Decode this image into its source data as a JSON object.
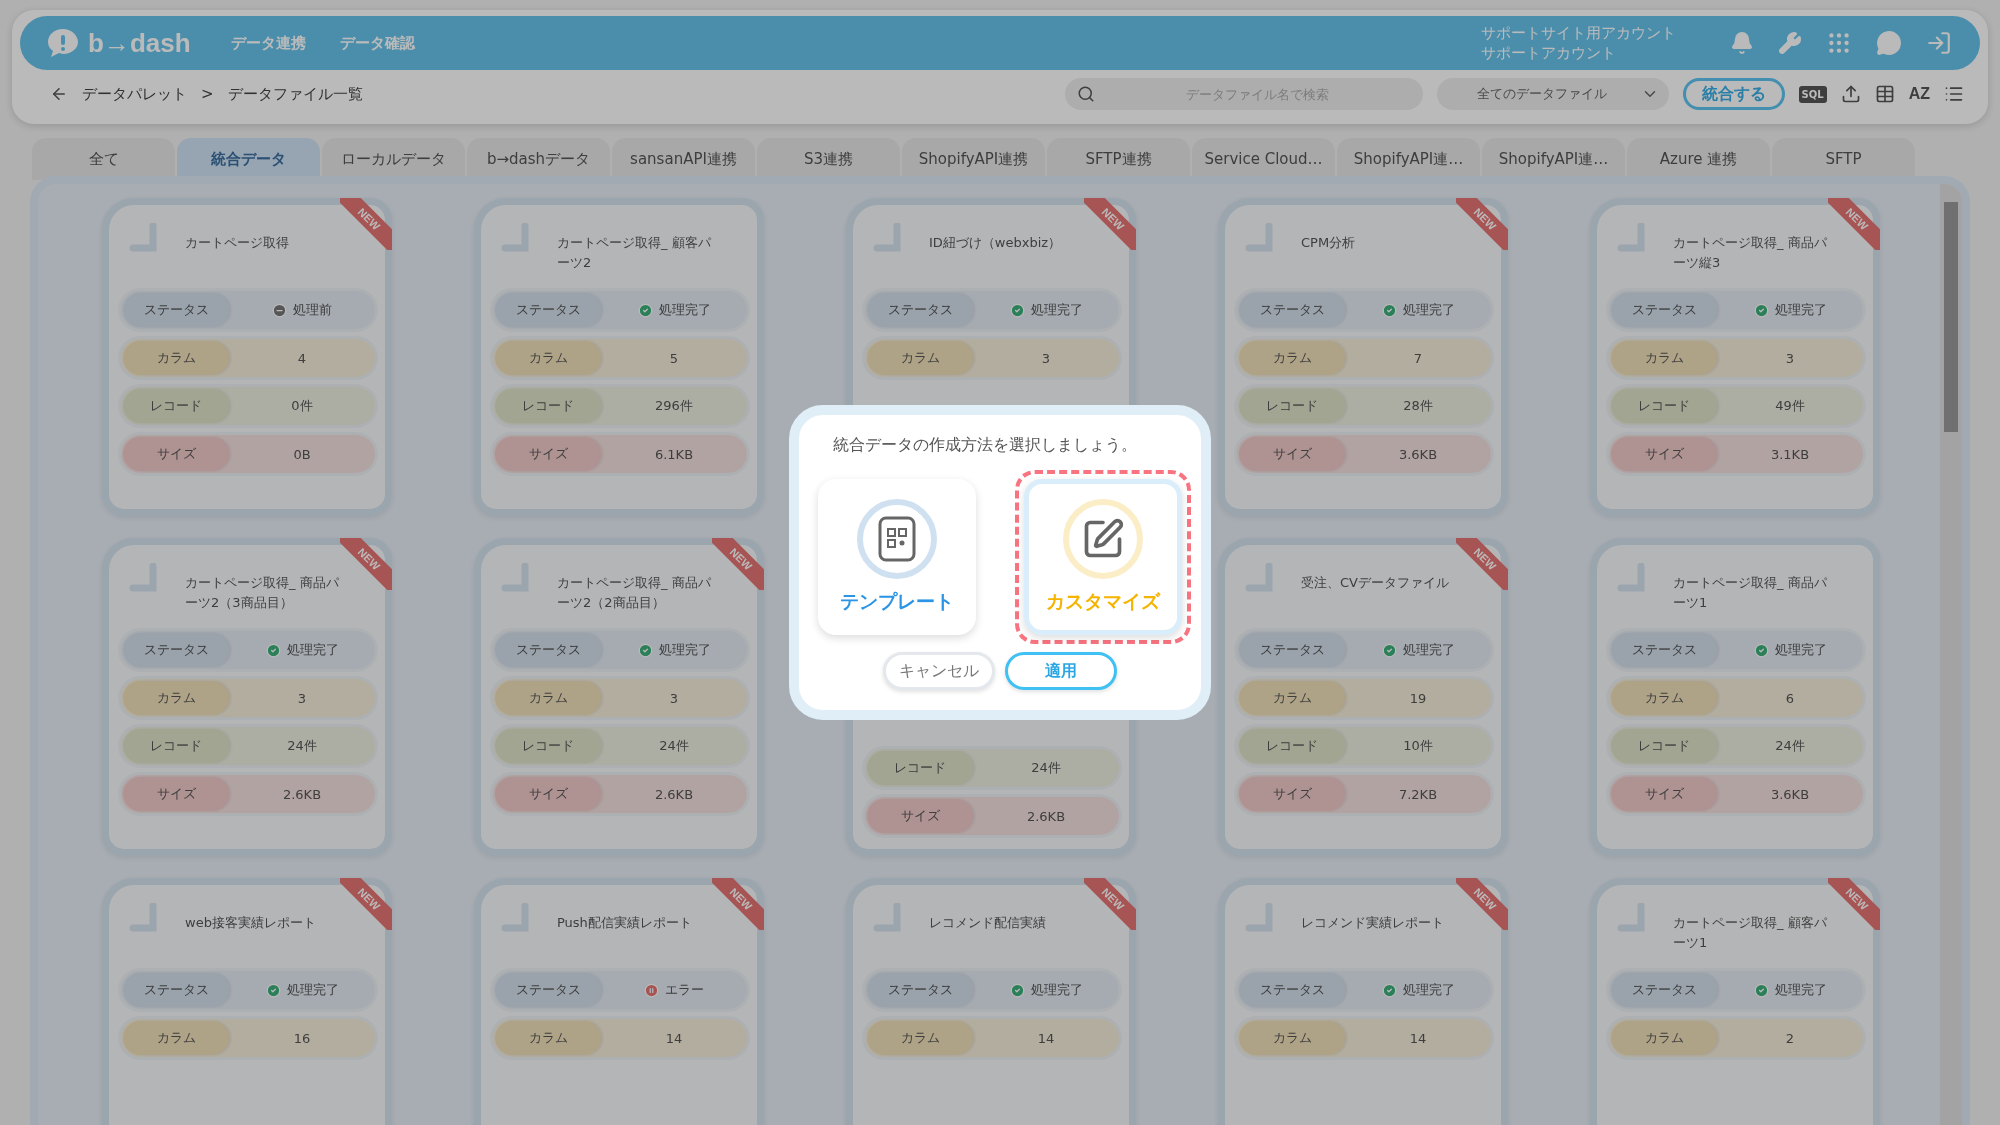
{
  "header": {
    "logo": "b→dash",
    "nav": [
      "データ連携",
      "データ確認"
    ],
    "account": [
      "サポートサイト用アカウント",
      "サポートアカウント"
    ]
  },
  "toolbar": {
    "breadcrumb": [
      "データパレット",
      ">",
      "データファイル一覧"
    ],
    "search": {
      "placeholder": "データファイル名で検索"
    },
    "filter": "全てのデータファイル",
    "merge_button": "統合する",
    "sql_label": "SQL",
    "sort_label": "AZ"
  },
  "tabs": [
    {
      "label": "全て",
      "selected": false
    },
    {
      "label": "統合データ",
      "selected": true
    },
    {
      "label": "ローカルデータ",
      "selected": false
    },
    {
      "label": "b→dashデータ",
      "selected": false
    },
    {
      "label": "sansanAPI連携",
      "selected": false
    },
    {
      "label": "S3連携",
      "selected": false
    },
    {
      "label": "ShopifyAPI連携",
      "selected": false
    },
    {
      "label": "SFTP連携",
      "selected": false
    },
    {
      "label": "Service Cloud…",
      "selected": false
    },
    {
      "label": "ShopifyAPI連…",
      "selected": false
    },
    {
      "label": "ShopifyAPI連…",
      "selected": false
    },
    {
      "label": "Azure 連携",
      "selected": false
    },
    {
      "label": "SFTP",
      "selected": false
    }
  ],
  "cards": [
    {
      "title": "カートページ取得",
      "badge": "NEW",
      "rows": [
        {
          "kind": "status",
          "label": "ステータス",
          "value": "処理前",
          "complete": false,
          "error": false
        },
        {
          "kind": "columns",
          "label": "カラム",
          "value": "4"
        },
        {
          "kind": "records",
          "label": "レコード",
          "value": "0件"
        },
        {
          "kind": "size",
          "label": "サイズ",
          "value": "0B"
        }
      ]
    },
    {
      "title": "カートページ取得_ 顧客パーツ2",
      "rows": [
        {
          "kind": "status",
          "label": "ステータス",
          "value": "処理完了",
          "complete": true,
          "error": false
        },
        {
          "kind": "columns",
          "label": "カラム",
          "value": "5"
        },
        {
          "kind": "records",
          "label": "レコード",
          "value": "296件"
        },
        {
          "kind": "size",
          "label": "サイズ",
          "value": "6.1KB"
        }
      ]
    },
    {
      "title": "ID紐づけ（webxbiz）",
      "badge": "NEW",
      "rows": [
        {
          "kind": "status",
          "label": "ステータス",
          "value": "処理完了",
          "complete": true,
          "error": false
        },
        {
          "kind": "columns",
          "label": "カラム",
          "value": "3"
        }
      ]
    },
    {
      "title": "CPM分析",
      "badge": "NEW",
      "rows": [
        {
          "kind": "status",
          "label": "ステータス",
          "value": "処理完了",
          "complete": true,
          "error": false
        },
        {
          "kind": "columns",
          "label": "カラム",
          "value": "7"
        },
        {
          "kind": "records",
          "label": "レコード",
          "value": "28件"
        },
        {
          "kind": "size",
          "label": "サイズ",
          "value": "3.6KB"
        }
      ]
    },
    {
      "title": "カートページ取得_ 商品パーツ縦3",
      "badge": "NEW",
      "rows": [
        {
          "kind": "status",
          "label": "ステータス",
          "value": "処理完了",
          "complete": true,
          "error": false
        },
        {
          "kind": "columns",
          "label": "カラム",
          "value": "3"
        },
        {
          "kind": "records",
          "label": "レコード",
          "value": "49件"
        },
        {
          "kind": "size",
          "label": "サイズ",
          "value": "3.1KB"
        }
      ]
    },
    {
      "title": "カートページ取得_ 商品パーツ2（3商品目）",
      "badge": "NEW",
      "rows": [
        {
          "kind": "status",
          "label": "ステータス",
          "value": "処理完了",
          "complete": true,
          "error": false
        },
        {
          "kind": "columns",
          "label": "カラム",
          "value": "3"
        },
        {
          "kind": "records",
          "label": "レコード",
          "value": "24件"
        },
        {
          "kind": "size",
          "label": "サイズ",
          "value": "2.6KB"
        }
      ]
    },
    {
      "title": "カートページ取得_ 商品パーツ2（2商品目）",
      "badge": "NEW",
      "rows": [
        {
          "kind": "status",
          "label": "ステータス",
          "value": "処理完了",
          "complete": true,
          "error": false
        },
        {
          "kind": "columns",
          "label": "カラム",
          "value": "3"
        },
        {
          "kind": "records",
          "label": "レコード",
          "value": "24件"
        },
        {
          "kind": "size",
          "label": "サイズ",
          "value": "2.6KB"
        }
      ]
    },
    {
      "covered": true,
      "rows": [
        {
          "kind": "records",
          "label": "レコード",
          "value": "24件"
        },
        {
          "kind": "size",
          "label": "サイズ",
          "value": "2.6KB"
        }
      ]
    },
    {
      "title": "受注、CVデータファイル",
      "badge": "NEW",
      "rows": [
        {
          "kind": "status",
          "label": "ステータス",
          "value": "処理完了",
          "complete": true,
          "error": false
        },
        {
          "kind": "columns",
          "label": "カラム",
          "value": "19"
        },
        {
          "kind": "records",
          "label": "レコード",
          "value": "10件"
        },
        {
          "kind": "size",
          "label": "サイズ",
          "value": "7.2KB"
        }
      ]
    },
    {
      "title": "カートページ取得_ 商品パーツ1",
      "rows": [
        {
          "kind": "status",
          "label": "ステータス",
          "value": "処理完了",
          "complete": true,
          "error": false
        },
        {
          "kind": "columns",
          "label": "カラム",
          "value": "6"
        },
        {
          "kind": "records",
          "label": "レコード",
          "value": "24件"
        },
        {
          "kind": "size",
          "label": "サイズ",
          "value": "3.6KB"
        }
      ]
    },
    {
      "title": "web接客実績レポート",
      "badge": "NEW",
      "rows": [
        {
          "kind": "status",
          "label": "ステータス",
          "value": "処理完了",
          "complete": true,
          "error": false
        },
        {
          "kind": "columns",
          "label": "カラム",
          "value": "16"
        }
      ]
    },
    {
      "title": "Push配信実績レポート",
      "badge": "NEW",
      "rows": [
        {
          "kind": "status",
          "label": "ステータス",
          "value": "エラー",
          "error": true
        },
        {
          "kind": "columns",
          "label": "カラム",
          "value": "14"
        }
      ]
    },
    {
      "title": "レコメンド配信実績",
      "badge": "NEW",
      "rows": [
        {
          "kind": "status",
          "label": "ステータス",
          "value": "処理完了",
          "complete": true,
          "error": false
        },
        {
          "kind": "columns",
          "label": "カラム",
          "value": "14"
        }
      ]
    },
    {
      "title": "レコメンド実績レポート",
      "badge": "NEW",
      "rows": [
        {
          "kind": "status",
          "label": "ステータス",
          "value": "処理完了",
          "complete": true,
          "error": false
        },
        {
          "kind": "columns",
          "label": "カラム",
          "value": "14"
        }
      ]
    },
    {
      "title": "カートページ取得_ 顧客パーツ1",
      "badge": "NEW",
      "rows": [
        {
          "kind": "status",
          "label": "ステータス",
          "value": "処理完了",
          "complete": true,
          "error": false
        },
        {
          "kind": "columns",
          "label": "カラム",
          "value": "2"
        }
      ]
    }
  ],
  "dialog": {
    "message": "統合データの作成方法を選択しましょう。",
    "options": [
      {
        "kind": "template",
        "label": "テンプレート",
        "selected": false
      },
      {
        "kind": "custom",
        "label": "カスタマイズ",
        "selected": true
      }
    ],
    "buttons": [
      {
        "kind": "cancel",
        "label": "キャンセル"
      },
      {
        "kind": "apply",
        "label": "適用"
      }
    ]
  }
}
